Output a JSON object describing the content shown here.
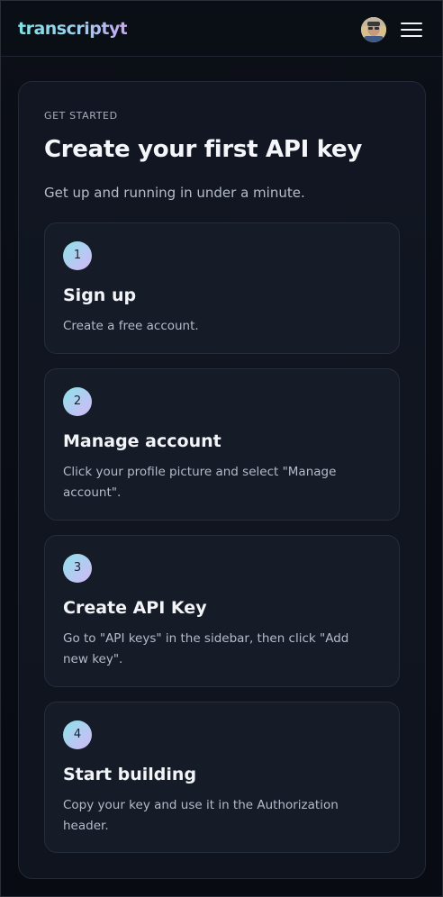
{
  "header": {
    "logo": "transcriptyt",
    "avatar_icon": "user-avatar",
    "menu_icon": "hamburger-icon"
  },
  "main": {
    "eyebrow": "GET STARTED",
    "title": "Create your first API key",
    "subtitle": "Get up and running in under a minute.",
    "steps": [
      {
        "number": "1",
        "title": "Sign up",
        "description": "Create a free account."
      },
      {
        "number": "2",
        "title": "Manage account",
        "description": "Click your profile picture and select \"Manage account\"."
      },
      {
        "number": "3",
        "title": "Create API Key",
        "description": "Go to \"API keys\" in the sidebar, then click \"Add new key\"."
      },
      {
        "number": "4",
        "title": "Start building",
        "description": "Copy your key and use it in the Authorization header."
      }
    ]
  },
  "colors": {
    "background": "#090c12",
    "card": "#111622",
    "step_card": "#151b27",
    "accent_start": "#8ce3e6",
    "accent_end": "#d3b8f5"
  }
}
